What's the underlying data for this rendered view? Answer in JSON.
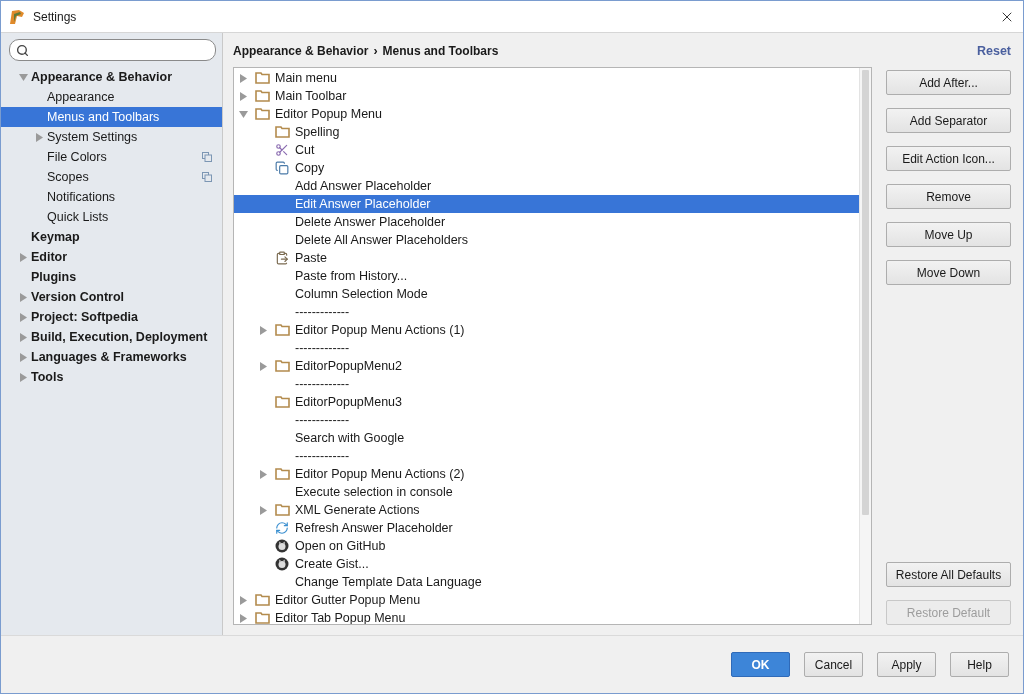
{
  "window": {
    "title": "Settings"
  },
  "sidebar": {
    "items": [
      {
        "label": "Appearance & Behavior",
        "expanded": true,
        "selected": false,
        "children": [
          {
            "label": "Appearance",
            "selected": false
          },
          {
            "label": "Menus and Toolbars",
            "selected": true
          },
          {
            "label": "System Settings",
            "expanded": false,
            "selected": false
          },
          {
            "label": "File Colors",
            "selected": false,
            "project_badge": true
          },
          {
            "label": "Scopes",
            "selected": false,
            "project_badge": true
          },
          {
            "label": "Notifications",
            "selected": false
          },
          {
            "label": "Quick Lists",
            "selected": false
          }
        ]
      },
      {
        "label": "Keymap",
        "selected": false
      },
      {
        "label": "Editor",
        "expanded": false,
        "selected": false
      },
      {
        "label": "Plugins",
        "selected": false
      },
      {
        "label": "Version Control",
        "expanded": false,
        "selected": false
      },
      {
        "label": "Project: Softpedia",
        "expanded": false,
        "selected": false
      },
      {
        "label": "Build, Execution, Deployment",
        "expanded": false,
        "selected": false
      },
      {
        "label": "Languages & Frameworks",
        "expanded": false,
        "selected": false
      },
      {
        "label": "Tools",
        "expanded": false,
        "selected": false
      }
    ]
  },
  "breadcrumb": {
    "parent": "Appearance & Behavior",
    "separator": "›",
    "current": "Menus and Toolbars"
  },
  "reset_link": "Reset",
  "tree": [
    {
      "label": "Main menu",
      "kind": "folder",
      "expanded": false,
      "selected": false
    },
    {
      "label": "Main Toolbar",
      "kind": "folder",
      "expanded": false,
      "selected": false
    },
    {
      "label": "Editor Popup Menu",
      "kind": "folder",
      "expanded": true,
      "selected": false,
      "children": [
        {
          "label": "Spelling",
          "kind": "folder",
          "selected": false
        },
        {
          "label": "Cut",
          "kind": "cut",
          "selected": false
        },
        {
          "label": "Copy",
          "kind": "copy",
          "selected": false
        },
        {
          "label": "Add Answer Placeholder",
          "kind": "action",
          "selected": false
        },
        {
          "label": "Edit Answer Placeholder",
          "kind": "action",
          "selected": true
        },
        {
          "label": "Delete Answer Placeholder",
          "kind": "action",
          "selected": false
        },
        {
          "label": "Delete All Answer Placeholders",
          "kind": "action",
          "selected": false
        },
        {
          "label": "Paste",
          "kind": "paste",
          "selected": false
        },
        {
          "label": "Paste from History...",
          "kind": "action",
          "selected": false
        },
        {
          "label": "Column Selection Mode",
          "kind": "action",
          "selected": false
        },
        {
          "label": "-------------",
          "kind": "separator",
          "selected": false
        },
        {
          "label": "Editor Popup Menu Actions (1)",
          "kind": "folder",
          "expanded": false,
          "selected": false
        },
        {
          "label": "-------------",
          "kind": "separator",
          "selected": false
        },
        {
          "label": "EditorPopupMenu2",
          "kind": "folder",
          "expanded": false,
          "selected": false
        },
        {
          "label": "-------------",
          "kind": "separator",
          "selected": false
        },
        {
          "label": "EditorPopupMenu3",
          "kind": "folder",
          "selected": false
        },
        {
          "label": "-------------",
          "kind": "separator",
          "selected": false
        },
        {
          "label": "Search with Google",
          "kind": "action",
          "selected": false
        },
        {
          "label": "-------------",
          "kind": "separator",
          "selected": false
        },
        {
          "label": "Editor Popup Menu Actions (2)",
          "kind": "folder",
          "expanded": false,
          "selected": false
        },
        {
          "label": "Execute selection in console",
          "kind": "action",
          "selected": false
        },
        {
          "label": "XML Generate Actions",
          "kind": "folder",
          "expanded": false,
          "selected": false
        },
        {
          "label": "Refresh Answer Placeholder",
          "kind": "refresh",
          "selected": false
        },
        {
          "label": "Open on GitHub",
          "kind": "github",
          "selected": false
        },
        {
          "label": "Create Gist...",
          "kind": "github",
          "selected": false
        },
        {
          "label": "Change Template Data Language",
          "kind": "action",
          "selected": false
        }
      ]
    },
    {
      "label": "Editor Gutter Popup Menu",
      "kind": "folder",
      "expanded": false,
      "selected": false
    },
    {
      "label": "Editor Tab Popup Menu",
      "kind": "folder",
      "expanded": false,
      "selected": false
    }
  ],
  "side_buttons": [
    {
      "label": "Add After...",
      "disabled": false
    },
    {
      "label": "Add Separator",
      "disabled": false
    },
    {
      "label": "Edit Action Icon...",
      "disabled": false
    },
    {
      "label": "Remove",
      "disabled": false
    },
    {
      "label": "Move Up",
      "disabled": false
    },
    {
      "label": "Move Down",
      "disabled": false
    }
  ],
  "defaults_buttons": [
    {
      "label": "Restore All Defaults",
      "disabled": false
    },
    {
      "label": "Restore Default",
      "disabled": true
    }
  ],
  "footer_buttons": [
    {
      "label": "OK",
      "primary": true
    },
    {
      "label": "Cancel",
      "primary": false
    },
    {
      "label": "Apply",
      "primary": false
    },
    {
      "label": "Help",
      "primary": false
    }
  ]
}
